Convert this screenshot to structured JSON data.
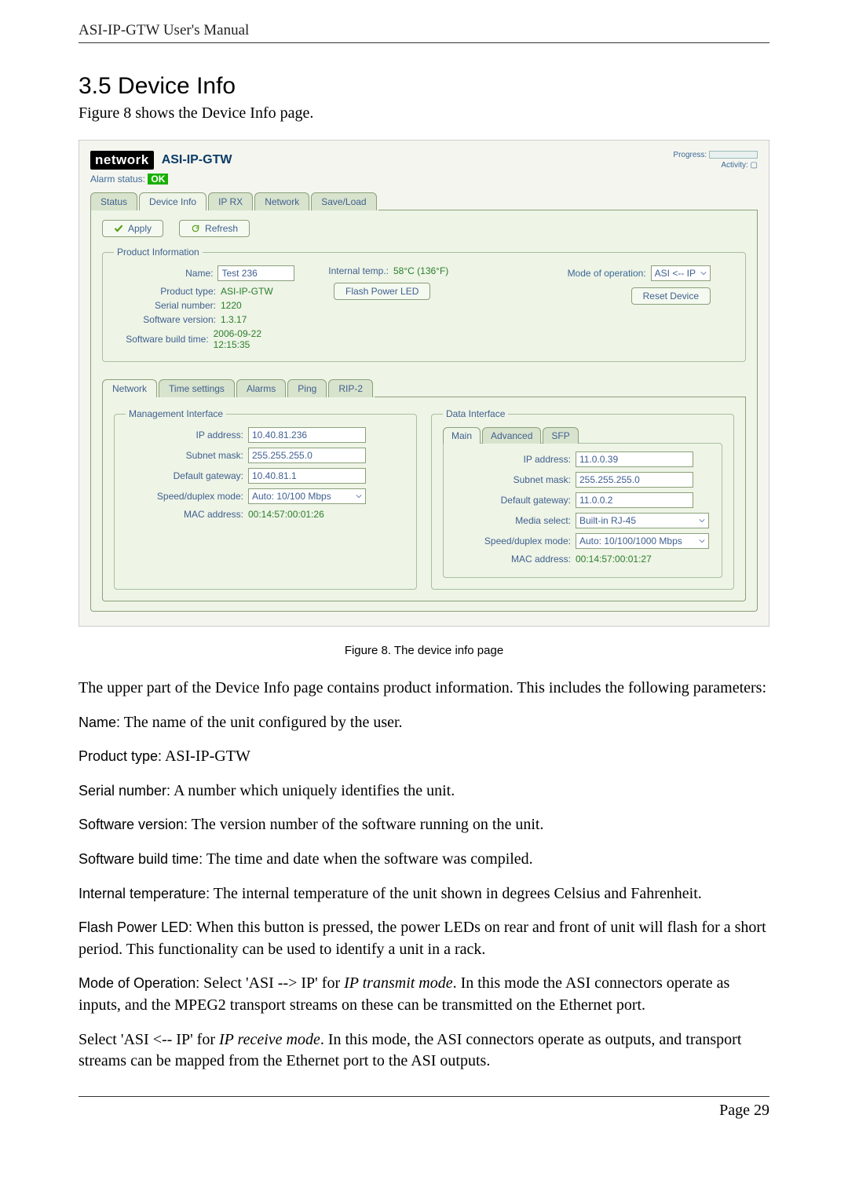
{
  "header": "ASI-IP-GTW User's Manual",
  "section_title": "3.5  Device Info",
  "intro_text": "Figure 8 shows the Device Info page.",
  "caption": "Figure 8. The device info page",
  "footer": "Page 29",
  "screenshot": {
    "brand": "network",
    "product": "ASI-IP-GTW",
    "progress_label": "Progress:",
    "activity_label": "Activity:",
    "alarm_label": "Alarm status:",
    "alarm_value": "OK",
    "main_tabs": [
      "Status",
      "Device Info",
      "IP RX",
      "Network",
      "Save/Load"
    ],
    "apply_label": "Apply",
    "refresh_label": "Refresh",
    "prod_info_legend": "Product Information",
    "name_label": "Name:",
    "name_value": "Test 236",
    "ptype_label": "Product type:",
    "ptype_value": "ASI-IP-GTW",
    "serial_label": "Serial number:",
    "serial_value": "1220",
    "swver_label": "Software version:",
    "swver_value": "1.3.17",
    "swbuild_label": "Software build time:",
    "swbuild_value": "2006-09-22 12:15:35",
    "intemp_label": "Internal temp.:",
    "intemp_value": "58°C (136°F)",
    "flash_led_label": "Flash Power LED",
    "mode_label": "Mode of operation:",
    "mode_value": "ASI <-- IP",
    "reset_label": "Reset Device",
    "inner_tabs": [
      "Network",
      "Time settings",
      "Alarms",
      "Ping",
      "RIP-2"
    ],
    "mgmt_legend": "Management Interface",
    "mgmt": {
      "ip_label": "IP address:",
      "ip_value": "10.40.81.236",
      "mask_label": "Subnet mask:",
      "mask_value": "255.255.255.0",
      "gw_label": "Default gateway:",
      "gw_value": "10.40.81.1",
      "speed_label": "Speed/duplex mode:",
      "speed_value": "Auto: 10/100 Mbps",
      "mac_label": "MAC address:",
      "mac_value": "00:14:57:00:01:26"
    },
    "data_legend": "Data Interface",
    "data_tabs": [
      "Main",
      "Advanced",
      "SFP"
    ],
    "data": {
      "ip_label": "IP address:",
      "ip_value": "11.0.0.39",
      "mask_label": "Subnet mask:",
      "mask_value": "255.255.255.0",
      "gw_label": "Default gateway:",
      "gw_value": "11.0.0.2",
      "media_label": "Media select:",
      "media_value": "Built-in RJ-45",
      "speed_label": "Speed/duplex mode:",
      "speed_value": "Auto: 10/100/1000 Mbps",
      "mac_label": "MAC address:",
      "mac_value": "00:14:57:00:01:27"
    }
  },
  "paragraphs": {
    "p1": "The upper part of the Device Info page contains product information. This includes the following parameters:",
    "name_term": "Name:",
    "name_desc": " The name of the unit configured by the user.",
    "ptype_term": "Product type:",
    "ptype_desc": " ASI-IP-GTW",
    "serial_term": "Serial number:",
    "serial_desc": " A number which uniquely identifies the unit.",
    "swver_term": "Software version:",
    "swver_desc": " The version number of the software running on the unit.",
    "swbuild_term": "Software build time:",
    "swbuild_desc": " The time and date when the software was compiled.",
    "intemp_term": "Internal temperature:",
    "intemp_desc": " The internal temperature of the unit shown in degrees Celsius and Fahrenheit.",
    "flash_term": "Flash Power LED:",
    "flash_desc": " When this button is pressed, the power LEDs on rear and front of unit will flash for a short period. This functionality can be used to identify a unit in a rack.",
    "mode_term": "Mode of Operation:",
    "mode_desc_a": " Select 'ASI --> IP' for ",
    "mode_desc_i1": "IP transmit mode",
    "mode_desc_b": ". In this mode the ASI connectors operate as inputs, and the MPEG2 transport streams on these can be transmitted on the Ethernet port.",
    "mode2_a": "Select 'ASI <-- IP' for ",
    "mode2_i": "IP receive mode",
    "mode2_b": ". In this mode, the ASI connectors operate as outputs, and transport streams can be mapped from the Ethernet port to the ASI outputs."
  }
}
